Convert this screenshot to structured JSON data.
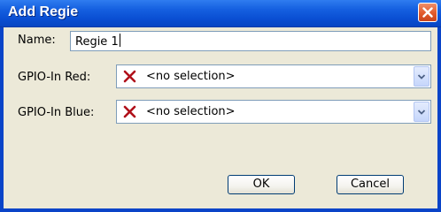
{
  "window": {
    "title": "Add Regie"
  },
  "form": {
    "name_label": "Name:",
    "name_value": "Regie 1",
    "gpio_red_label": "GPIO-In Red:",
    "gpio_red_value": "<no selection>",
    "gpio_blue_label": "GPIO-In Blue:",
    "gpio_blue_value": "<no selection>"
  },
  "buttons": {
    "ok": "OK",
    "cancel": "Cancel"
  },
  "icons": {
    "close": "close-icon",
    "no_selection": "x-mark-icon",
    "dropdown": "chevron-down-icon"
  },
  "colors": {
    "x_mark": "#b0101a",
    "titlebar": "#0a4fd3",
    "dialog_bg": "#ece9d8"
  }
}
